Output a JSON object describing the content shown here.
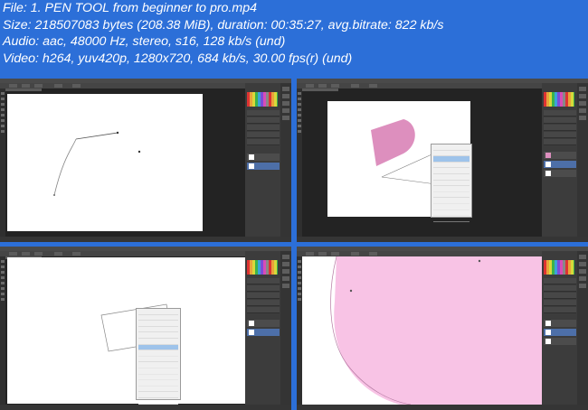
{
  "file_info": {
    "line1": "File: 1. PEN TOOL from beginner to pro.mp4",
    "line2": "Size: 218507083 bytes (208.38 MiB), duration: 00:35:27, avg.bitrate: 822 kb/s",
    "line3": "Audio: aac, 48000 Hz, stereo, s16, 128 kb/s (und)",
    "line4": "Video: h264, yuv420p, 1280x720, 684 kb/s, 30.00 fps(r) (und)"
  },
  "colors": {
    "background": "#2c6fd8",
    "shape_mauve": "#dd8fbe",
    "shape_pink": "#f8c3e5",
    "highlight": "#9ec3ea"
  },
  "thumbnails": [
    {
      "frame": 1,
      "content": "curved-path"
    },
    {
      "frame": 2,
      "content": "shape-with-context-menu"
    },
    {
      "frame": 3,
      "content": "rectangle-with-context-menu"
    },
    {
      "frame": 4,
      "content": "large-pink-shape"
    }
  ]
}
